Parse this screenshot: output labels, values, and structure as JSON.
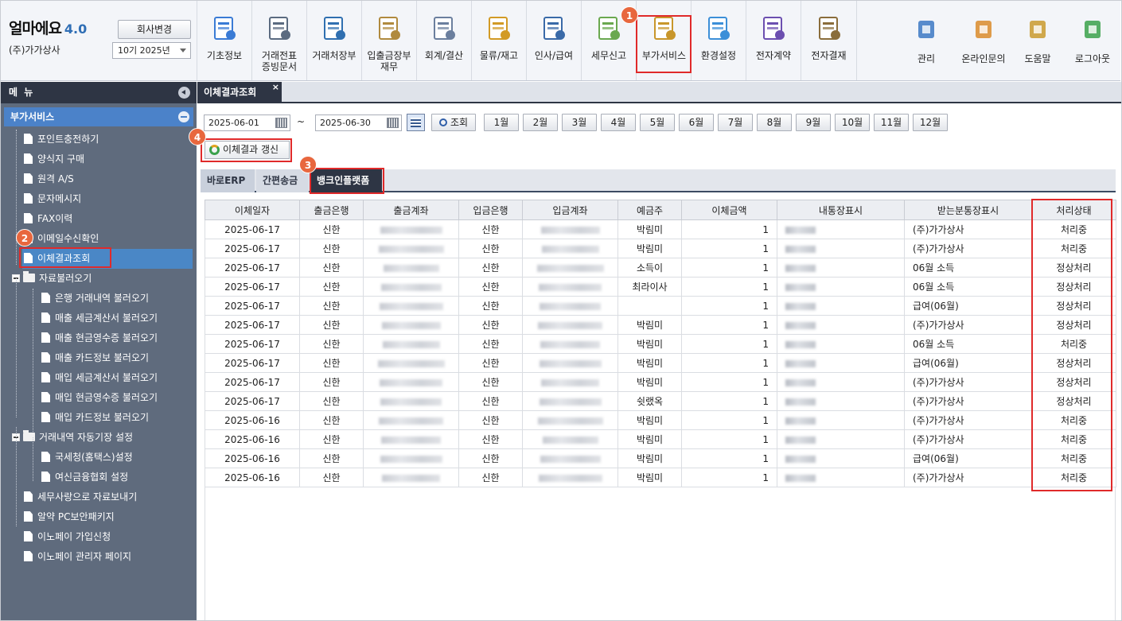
{
  "app": {
    "logo_name": "얼마에요",
    "logo_version": "4.0",
    "company_name": "(주)가가상사",
    "company_change_label": "회사변경",
    "period_label": "10기 2025년"
  },
  "toolbar": [
    {
      "label": "기초정보",
      "icon": "gear-document-icon"
    },
    {
      "label": "거래전표\n증빙문서",
      "icon": "voucher-icon"
    },
    {
      "label": "거래처장부",
      "icon": "ledger-book-icon"
    },
    {
      "label": "입출금장부\n재무",
      "icon": "money-bag-icon"
    },
    {
      "label": "회계/결산",
      "icon": "clipboard-icon"
    },
    {
      "label": "물류/재고",
      "icon": "cart-icon"
    },
    {
      "label": "인사/급여",
      "icon": "person-icon"
    },
    {
      "label": "세무신고",
      "icon": "tax-icon"
    },
    {
      "label": "부가서비스",
      "icon": "bank-icon"
    },
    {
      "label": "환경설정",
      "icon": "settings-gear-icon"
    },
    {
      "label": "전자계약",
      "icon": "pen-signature-icon"
    },
    {
      "label": "전자결재",
      "icon": "approval-icon"
    }
  ],
  "right_toolbar": [
    {
      "label": "관리",
      "icon": "puzzle-icon"
    },
    {
      "label": "온라인문의",
      "icon": "support-agent-icon"
    },
    {
      "label": "도움말",
      "icon": "help-book-icon"
    },
    {
      "label": "로그아웃",
      "icon": "logout-door-icon"
    }
  ],
  "sidebar": {
    "title": "메 뉴",
    "section": "부가서비스",
    "items": [
      {
        "label": "포인트충전하기",
        "type": "doc",
        "level": 1
      },
      {
        "label": "양식지 구매",
        "type": "doc",
        "level": 1
      },
      {
        "label": "원격 A/S",
        "type": "doc",
        "level": 1
      },
      {
        "label": "문자메시지",
        "type": "doc",
        "level": 1
      },
      {
        "label": "FAX이력",
        "type": "doc",
        "level": 1
      },
      {
        "label": "이메일수신확인",
        "type": "doc",
        "level": 1
      },
      {
        "label": "이체결과조회",
        "type": "doc",
        "level": 1,
        "selected": true
      },
      {
        "label": "자료불러오기",
        "type": "folder",
        "level": 0
      },
      {
        "label": "은행 거래내역 불러오기",
        "type": "doc",
        "level": 2
      },
      {
        "label": "매출 세금계산서 불러오기",
        "type": "doc",
        "level": 2
      },
      {
        "label": "매출 현금영수증 불러오기",
        "type": "doc",
        "level": 2
      },
      {
        "label": "매출 카드정보 불러오기",
        "type": "doc",
        "level": 2
      },
      {
        "label": "매입 세금계산서 불러오기",
        "type": "doc",
        "level": 2
      },
      {
        "label": "매입 현금영수증 불러오기",
        "type": "doc",
        "level": 2
      },
      {
        "label": "매입 카드정보 불러오기",
        "type": "doc",
        "level": 2
      },
      {
        "label": "거래내역 자동기장 설정",
        "type": "folder",
        "level": 0
      },
      {
        "label": "국세청(홈택스)설정",
        "type": "doc",
        "level": 2
      },
      {
        "label": "여신금융협회 설정",
        "type": "doc",
        "level": 2
      },
      {
        "label": "세무사랑으로 자료보내기",
        "type": "doc",
        "level": 1
      },
      {
        "label": "알약 PC보안패키지",
        "type": "doc",
        "level": 1
      },
      {
        "label": "이노페이 가입신청",
        "type": "doc",
        "level": 1
      },
      {
        "label": "이노페이 관리자 페이지",
        "type": "doc",
        "level": 1
      }
    ]
  },
  "main": {
    "tab_title": "이체결과조회",
    "tab_close": "×",
    "date_from": "2025-06-01",
    "date_to": "2025-06-30",
    "tilde": "~",
    "search_label": "조회",
    "months": [
      "1월",
      "2월",
      "3월",
      "4월",
      "5월",
      "6월",
      "7월",
      "8월",
      "9월",
      "10월",
      "11월",
      "12월"
    ],
    "refresh_label": "이체결과 갱신",
    "subtabs": [
      "바로ERP",
      "간편송금",
      "뱅크인플랫폼"
    ],
    "columns": [
      "이체일자",
      "출금은행",
      "출금계좌",
      "입금은행",
      "입금계좌",
      "예금주",
      "이체금액",
      "내통장표시",
      "받는분통장표시",
      "처리상태"
    ],
    "rows": [
      {
        "date": "2025-06-17",
        "out_bank": "신한",
        "in_bank": "신한",
        "holder": "박림미",
        "amount": "1",
        "recv_memo": "(주)가가상사",
        "status": "처리중"
      },
      {
        "date": "2025-06-17",
        "out_bank": "신한",
        "in_bank": "신한",
        "holder": "박림미",
        "amount": "1",
        "recv_memo": "(주)가가상사",
        "status": "처리중"
      },
      {
        "date": "2025-06-17",
        "out_bank": "신한",
        "in_bank": "신한",
        "holder": "소득이",
        "amount": "1",
        "recv_memo": "06월 소득",
        "status": "정상처리"
      },
      {
        "date": "2025-06-17",
        "out_bank": "신한",
        "in_bank": "신한",
        "holder": "최라이사",
        "amount": "1",
        "recv_memo": "06월 소득",
        "status": "정상처리"
      },
      {
        "date": "2025-06-17",
        "out_bank": "신한",
        "in_bank": "신한",
        "holder": "",
        "amount": "1",
        "recv_memo": "급여(06월)",
        "status": "정상처리"
      },
      {
        "date": "2025-06-17",
        "out_bank": "신한",
        "in_bank": "신한",
        "holder": "박림미",
        "amount": "1",
        "recv_memo": "(주)가가상사",
        "status": "정상처리"
      },
      {
        "date": "2025-06-17",
        "out_bank": "신한",
        "in_bank": "신한",
        "holder": "박림미",
        "amount": "1",
        "recv_memo": "06월 소득",
        "status": "처리중"
      },
      {
        "date": "2025-06-17",
        "out_bank": "신한",
        "in_bank": "신한",
        "holder": "박림미",
        "amount": "1",
        "recv_memo": "급여(06월)",
        "status": "정상처리"
      },
      {
        "date": "2025-06-17",
        "out_bank": "신한",
        "in_bank": "신한",
        "holder": "박림미",
        "amount": "1",
        "recv_memo": "(주)가가상사",
        "status": "정상처리"
      },
      {
        "date": "2025-06-17",
        "out_bank": "신한",
        "in_bank": "신한",
        "holder": "쉿랬옥",
        "amount": "1",
        "recv_memo": "(주)가가상사",
        "status": "정상처리"
      },
      {
        "date": "2025-06-16",
        "out_bank": "신한",
        "in_bank": "신한",
        "holder": "박림미",
        "amount": "1",
        "recv_memo": "(주)가가상사",
        "status": "처리중"
      },
      {
        "date": "2025-06-16",
        "out_bank": "신한",
        "in_bank": "신한",
        "holder": "박림미",
        "amount": "1",
        "recv_memo": "(주)가가상사",
        "status": "처리중"
      },
      {
        "date": "2025-06-16",
        "out_bank": "신한",
        "in_bank": "신한",
        "holder": "박림미",
        "amount": "1",
        "recv_memo": "급여(06월)",
        "status": "처리중"
      },
      {
        "date": "2025-06-16",
        "out_bank": "신한",
        "in_bank": "신한",
        "holder": "박림미",
        "amount": "1",
        "recv_memo": "(주)가가상사",
        "status": "처리중"
      }
    ]
  },
  "annotations": [
    "1",
    "2",
    "3",
    "4"
  ],
  "colors": {
    "highlight_red": "#e02a2a",
    "badge_orange": "#e8673e",
    "sidebar_bg": "#5f6b7d",
    "selected_blue": "#4a87c6",
    "header_dark": "#2e3544"
  }
}
